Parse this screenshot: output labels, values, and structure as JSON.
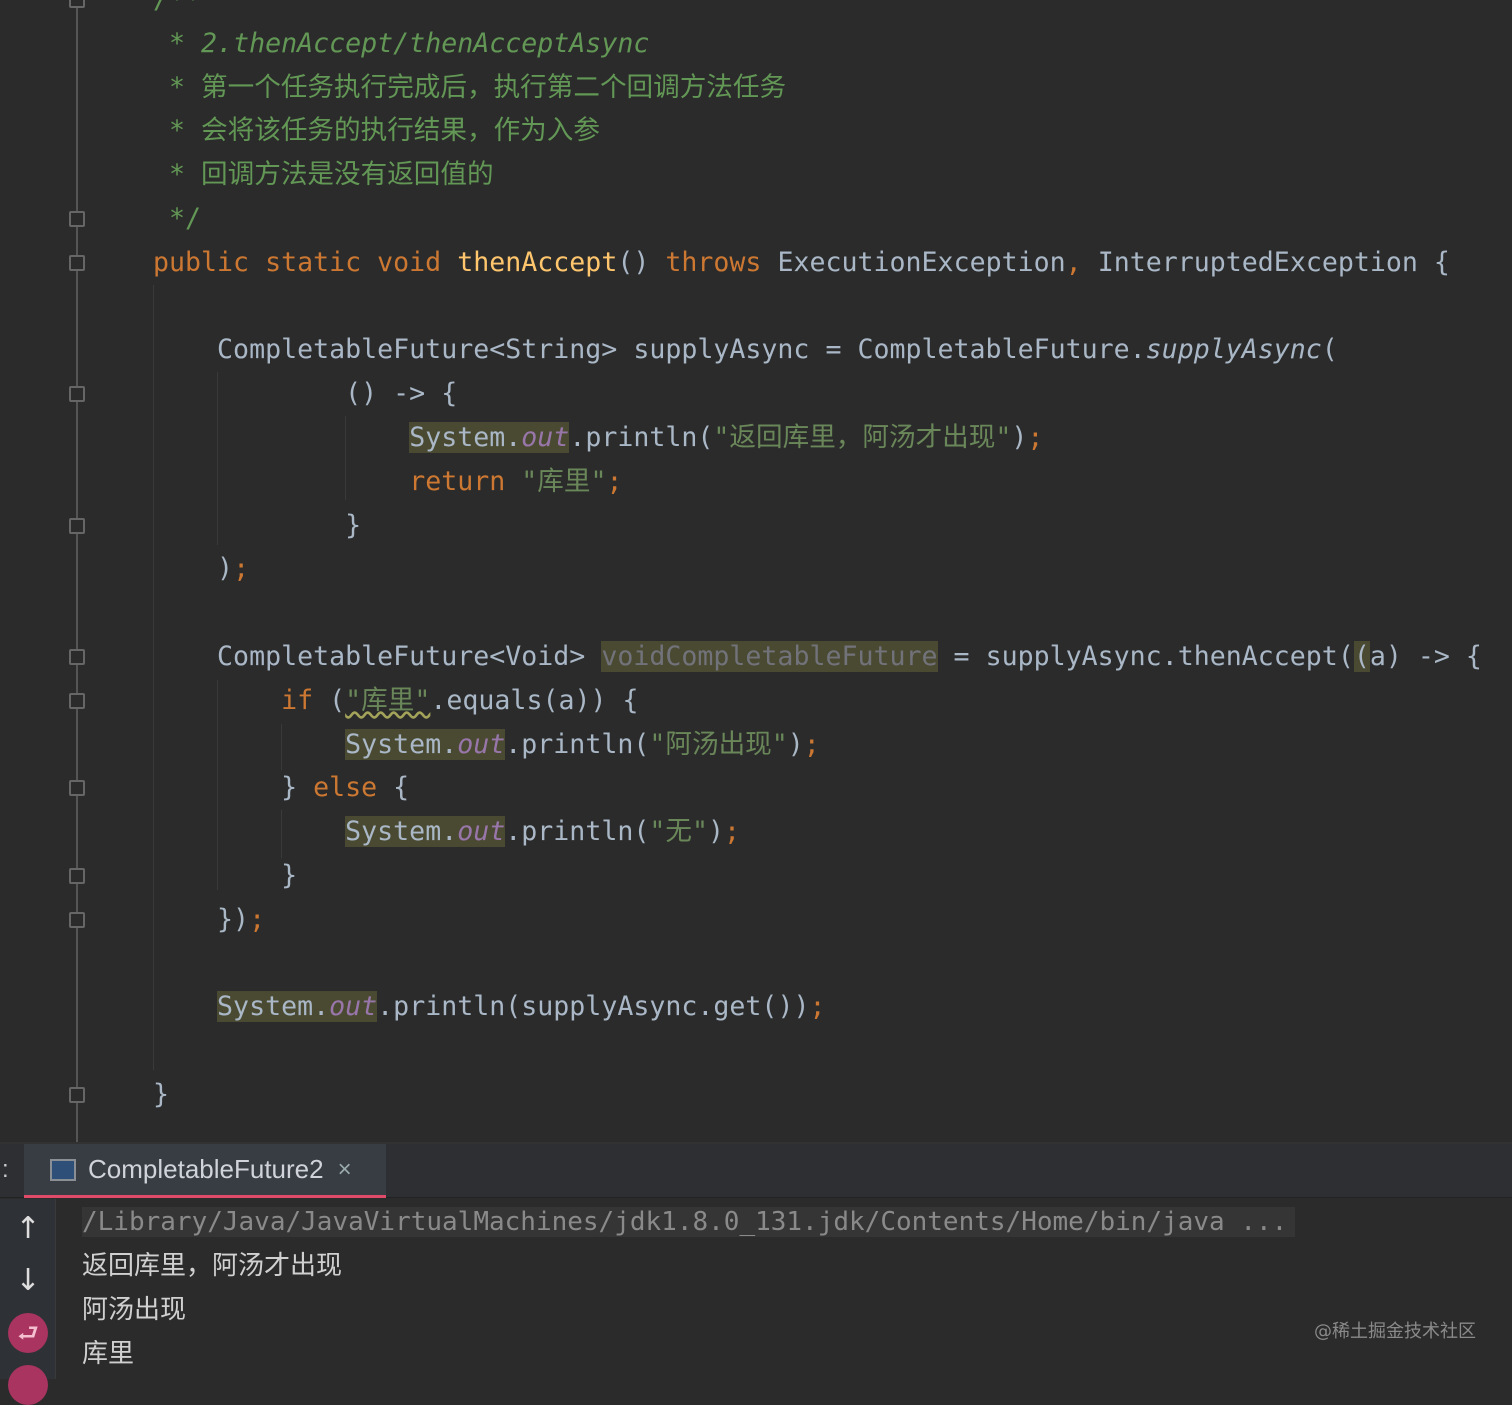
{
  "editor": {
    "lines": [
      [
        [
          "docc",
          "/**"
        ]
      ],
      [
        [
          "docc",
          " * "
        ],
        [
          "doc",
          "2.thenAccept/thenAcceptAsync"
        ]
      ],
      [
        [
          "docc",
          " * 第一个任务执行完成后，执行第二个回调方法任务"
        ]
      ],
      [
        [
          "docc",
          " * 会将该任务的执行结果，作为入参"
        ]
      ],
      [
        [
          "docc",
          " * 回调方法是没有返回值的"
        ]
      ],
      [
        [
          "docc",
          " */"
        ]
      ],
      [
        [
          "kw",
          "public static void "
        ],
        [
          "mth",
          "thenAccept"
        ],
        [
          "",
          "() "
        ],
        [
          "kw",
          "throws "
        ],
        [
          "",
          "ExecutionException"
        ],
        [
          "kw",
          ", "
        ],
        [
          "",
          "InterruptedException {"
        ]
      ],
      [],
      [
        [
          "",
          "    CompletableFuture<String> supplyAsync = CompletableFuture."
        ],
        [
          "ital",
          "supplyAsync"
        ],
        [
          "",
          "("
        ]
      ],
      [
        [
          "",
          "            () -> {"
        ]
      ],
      [
        [
          "",
          "                "
        ],
        [
          "hl",
          "System."
        ],
        [
          "fld hl",
          "out"
        ],
        [
          "",
          ".println("
        ],
        [
          "str",
          "\"返回库里，阿汤才出现\""
        ],
        [
          "",
          ")"
        ],
        [
          "semi",
          ";"
        ]
      ],
      [
        [
          "",
          "                "
        ],
        [
          "kw",
          "return "
        ],
        [
          "str",
          "\"库里\""
        ],
        [
          "semi",
          ";"
        ]
      ],
      [
        [
          "",
          "            }"
        ]
      ],
      [
        [
          "",
          "    )"
        ],
        [
          "semi",
          ";"
        ]
      ],
      [],
      [
        [
          "",
          "    CompletableFuture<Void> "
        ],
        [
          "unused",
          "voidCompletableFuture"
        ],
        [
          "",
          " = supplyAsync.thenAccept("
        ],
        [
          "hl",
          "("
        ],
        [
          "",
          "a) -> {"
        ]
      ],
      [
        [
          "",
          "        "
        ],
        [
          "kw",
          "if "
        ],
        [
          "",
          "("
        ],
        [
          "str wavy",
          "\"库里\""
        ],
        [
          "",
          ".equals(a)) {"
        ]
      ],
      [
        [
          "",
          "            "
        ],
        [
          "hl",
          "System."
        ],
        [
          "fld hl",
          "out"
        ],
        [
          "",
          ".println("
        ],
        [
          "str",
          "\"阿汤出现\""
        ],
        [
          "",
          ")"
        ],
        [
          "semi",
          ";"
        ]
      ],
      [
        [
          "",
          "        } "
        ],
        [
          "kw",
          "else "
        ],
        [
          "",
          "{"
        ]
      ],
      [
        [
          "",
          "            "
        ],
        [
          "hl",
          "System."
        ],
        [
          "fld hl",
          "out"
        ],
        [
          "",
          ".println("
        ],
        [
          "str",
          "\"无\""
        ],
        [
          "",
          ")"
        ],
        [
          "semi",
          ";"
        ]
      ],
      [
        [
          "",
          "        }"
        ]
      ],
      [
        [
          "",
          "    })"
        ],
        [
          "semi",
          ";"
        ]
      ],
      [],
      [
        [
          "",
          "    "
        ],
        [
          "hl",
          "System."
        ],
        [
          "fld hl",
          "out"
        ],
        [
          "",
          ".println(supplyAsync.get())"
        ],
        [
          "semi",
          ";"
        ]
      ],
      [],
      [
        [
          "",
          "}"
        ]
      ]
    ]
  },
  "console": {
    "tab_label": "CompletableFuture2",
    "colon": ":",
    "close_glyph": "×",
    "command": "/Library/Java/JavaVirtualMachines/jdk1.8.0_131.jdk/Contents/Home/bin/java ...",
    "output": [
      "返回库里，阿汤才出现",
      "阿汤出现",
      "库里"
    ],
    "icons": {
      "up": "↑",
      "down": "↓",
      "wrap": "⮐"
    }
  },
  "watermark": "@稀土掘金技术社区"
}
